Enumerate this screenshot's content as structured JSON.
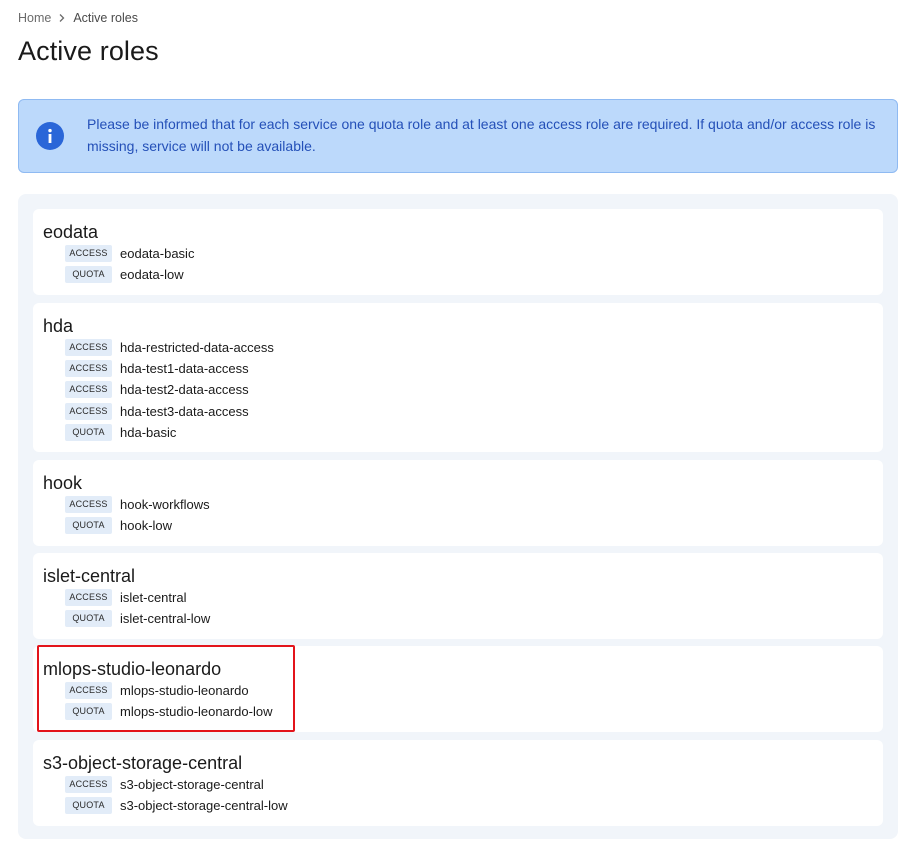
{
  "breadcrumb": {
    "home": "Home",
    "current": "Active roles",
    "separator_icon": "chevron-right-icon"
  },
  "page": {
    "title": "Active roles"
  },
  "banner": {
    "icon": "info-icon",
    "text": "Please be informed that for each service one quota role and at least one access role are required. If quota and/or access role is missing, service will not be available."
  },
  "services": [
    {
      "name": "eodata",
      "roles": [
        {
          "type": "ACCESS",
          "name": "eodata-basic"
        },
        {
          "type": "QUOTA",
          "name": "eodata-low"
        }
      ]
    },
    {
      "name": "hda",
      "roles": [
        {
          "type": "ACCESS",
          "name": "hda-restricted-data-access"
        },
        {
          "type": "ACCESS",
          "name": "hda-test1-data-access"
        },
        {
          "type": "ACCESS",
          "name": "hda-test2-data-access"
        },
        {
          "type": "ACCESS",
          "name": "hda-test3-data-access"
        },
        {
          "type": "QUOTA",
          "name": "hda-basic"
        }
      ]
    },
    {
      "name": "hook",
      "roles": [
        {
          "type": "ACCESS",
          "name": "hook-workflows"
        },
        {
          "type": "QUOTA",
          "name": "hook-low"
        }
      ]
    },
    {
      "name": "islet-central",
      "roles": [
        {
          "type": "ACCESS",
          "name": "islet-central"
        },
        {
          "type": "QUOTA",
          "name": "islet-central-low"
        }
      ]
    },
    {
      "name": "mlops-studio-leonardo",
      "roles": [
        {
          "type": "ACCESS",
          "name": "mlops-studio-leonardo"
        },
        {
          "type": "QUOTA",
          "name": "mlops-studio-leonardo-low"
        }
      ]
    },
    {
      "name": "s3-object-storage-central",
      "roles": [
        {
          "type": "ACCESS",
          "name": "s3-object-storage-central"
        },
        {
          "type": "QUOTA",
          "name": "s3-object-storage-central-low"
        }
      ]
    }
  ],
  "colors": {
    "banner_bg": "#bcd9fb",
    "banner_text": "#2450b8",
    "info_icon": "#2a66d8",
    "highlight": "#e3141b"
  }
}
